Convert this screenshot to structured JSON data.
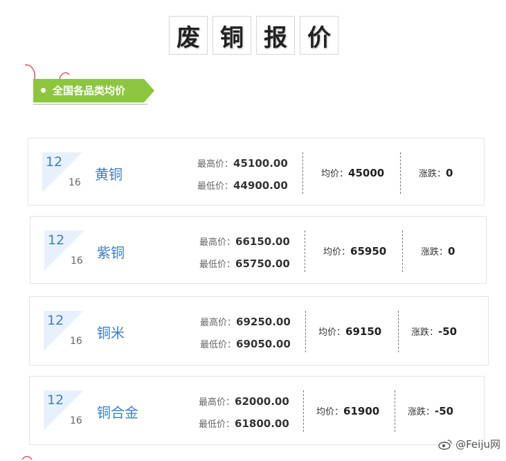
{
  "title_chars": [
    "废",
    "铜",
    "报",
    "价"
  ],
  "section_tag": "全国各品类均价",
  "labels": {
    "high": "最高价：",
    "low": "最低价：",
    "avg": "均价：",
    "change": "涨跌："
  },
  "colors": {
    "tag_green": "#8cc63f",
    "name_blue": "#3a7fc6",
    "date_bg": "#e8f1fb",
    "accent_red": "#e05060"
  },
  "items": [
    {
      "month": "12",
      "day": "16",
      "name": "黄铜",
      "high": "45100.00",
      "low": "44900.00",
      "avg": "45000",
      "change": "0"
    },
    {
      "month": "12",
      "day": "16",
      "name": "紫铜",
      "high": "66150.00",
      "low": "65750.00",
      "avg": "65950",
      "change": "0"
    },
    {
      "month": "12",
      "day": "16",
      "name": "铜米",
      "high": "69250.00",
      "low": "69050.00",
      "avg": "69150",
      "change": "-50"
    },
    {
      "month": "12",
      "day": "16",
      "name": "铜合金",
      "high": "62000.00",
      "low": "61800.00",
      "avg": "61900",
      "change": "-50"
    }
  ],
  "watermark": "@Feiju网"
}
